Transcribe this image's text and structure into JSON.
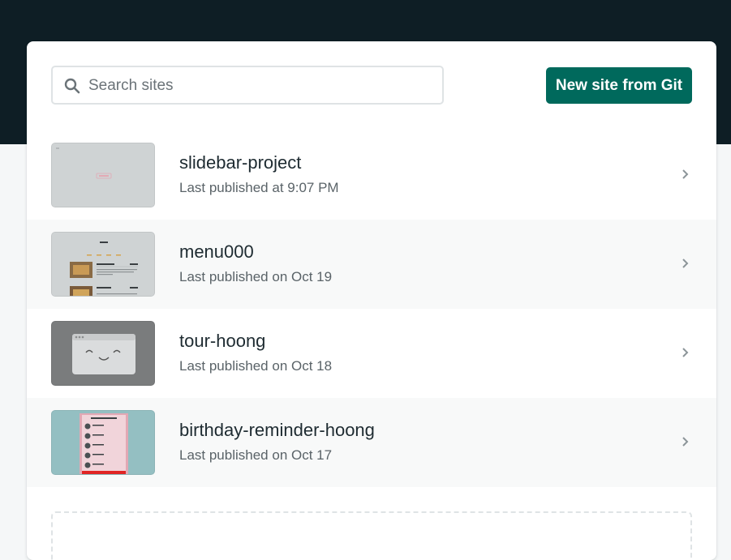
{
  "search": {
    "placeholder": "Search sites"
  },
  "toolbar": {
    "new_site_label": "New site from Git"
  },
  "sites": [
    {
      "name": "slidebar-project",
      "published": "Last published at 9:07 PM"
    },
    {
      "name": "menu000",
      "published": "Last published on Oct 19"
    },
    {
      "name": "tour-hoong",
      "published": "Last published on Oct 18"
    },
    {
      "name": "birthday-reminder-hoong",
      "published": "Last published on Oct 17"
    }
  ],
  "colors": {
    "header_bg": "#0e1e25",
    "primary_button": "#00695c",
    "page_bg": "#f5f7f8"
  },
  "icons": [
    "search-icon",
    "chevron-right-icon",
    "placeholder-face-icon"
  ]
}
